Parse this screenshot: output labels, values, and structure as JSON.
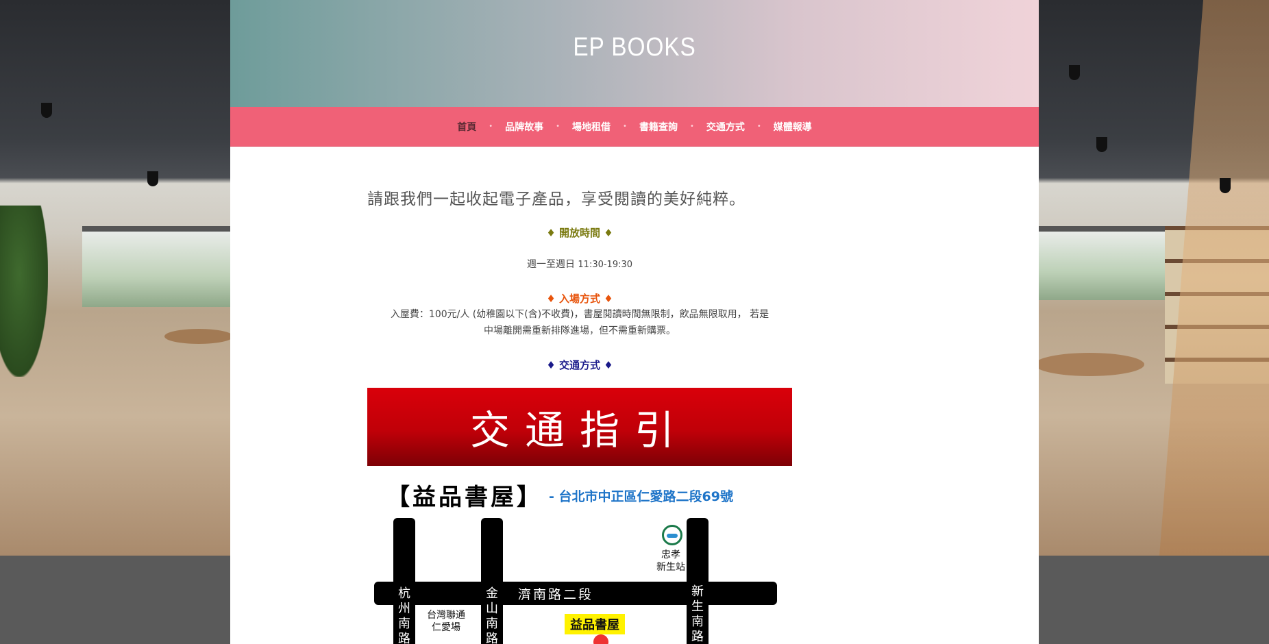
{
  "site": {
    "title": "EP BOOKS"
  },
  "nav": {
    "items": [
      {
        "label": "首頁"
      },
      {
        "label": "品牌故事"
      },
      {
        "label": "場地租借"
      },
      {
        "label": "書籍查詢"
      },
      {
        "label": "交通方式"
      },
      {
        "label": "媒體報導"
      }
    ],
    "separator": "•"
  },
  "main": {
    "tagline": "請跟我們一起收起電子產品，享受閱讀的美好純粹。",
    "hours": {
      "heading": "♦ 開放時間 ♦",
      "days": "週一至週日",
      "time": "11:30-19:30"
    },
    "admission": {
      "heading": "♦ 入場方式 ♦",
      "line1": "入屋費：100元/人 (幼稚園以下(含)不收費)，書屋閱讀時間無限制，飲品無限取用， 若是",
      "line2": "中場離開需重新排隊進場，但不需重新購票。"
    },
    "transport": {
      "heading": "♦ 交通方式 ♦"
    }
  },
  "guide": {
    "banner": "交通指引",
    "name": "【益品書屋】",
    "address": "- 台北市中正區仁愛路二段69號",
    "roads": {
      "hangzhou": "杭州南路",
      "jinshan": "金山南路",
      "xinsheng": "新生南路",
      "jinan": "濟南路二段"
    },
    "station": "忠孝\n新生站",
    "landmark": "台灣聯通\n仁愛場",
    "store_tag": "益品書屋"
  },
  "colors": {
    "nav_bg": "#f06177",
    "hours_heading": "#7a7a10",
    "admission_heading": "#e8540c",
    "transport_heading": "#1a1a8a",
    "banner_red": "#d9000a",
    "address_blue": "#1e74c8"
  }
}
